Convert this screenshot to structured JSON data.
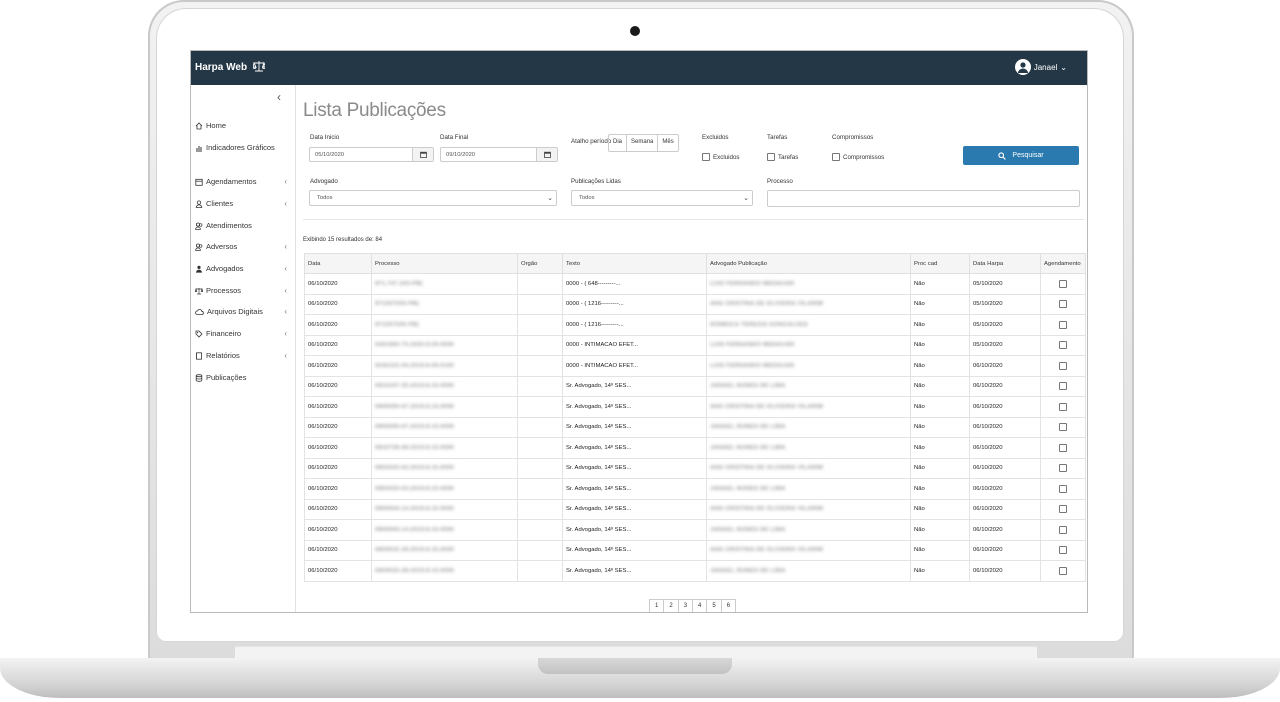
{
  "app": {
    "brand": "Harpa Web",
    "user": "Janael"
  },
  "sidebar": {
    "items": [
      {
        "label": "Home",
        "icon": "home-icon",
        "chevron": false
      },
      {
        "label": "Indicadores Gráficos",
        "icon": "chart-icon",
        "chevron": false
      },
      {
        "label": "Agendamentos",
        "icon": "calendar-icon",
        "chevron": true
      },
      {
        "label": "Clientes",
        "icon": "user-icon",
        "chevron": true
      },
      {
        "label": "Atendimentos",
        "icon": "users-icon",
        "chevron": false
      },
      {
        "label": "Adversos",
        "icon": "users-icon",
        "chevron": true
      },
      {
        "label": "Advogados",
        "icon": "lawyer-icon",
        "chevron": true
      },
      {
        "label": "Processos",
        "icon": "scale-icon",
        "chevron": true
      },
      {
        "label": "Arquivos Digitais",
        "icon": "cloud-icon",
        "chevron": true
      },
      {
        "label": "Financeiro",
        "icon": "tag-icon",
        "chevron": true
      },
      {
        "label": "Relatórios",
        "icon": "report-icon",
        "chevron": true
      },
      {
        "label": "Publicações",
        "icon": "database-icon",
        "chevron": false
      }
    ]
  },
  "page": {
    "title": "Lista Publicações"
  },
  "filters": {
    "data_inicio_label": "Data Inicio",
    "data_inicio_value": "05/10/2020",
    "data_final_label": "Data Final",
    "data_final_value": "09/10/2020",
    "atalho_label": "Atalho período",
    "atalho_options": [
      "Dia",
      "Semana",
      "Mês"
    ],
    "excluidos_title": "Excluidos",
    "excluidos_label": "Excluidos",
    "tarefas_title": "Tarefas",
    "tarefas_label": "Tarefas",
    "compromissos_title": "Compromissos",
    "compromissos_label": "Compromissos",
    "search_label": "Pesquisar",
    "advogado_label": "Advogado",
    "advogado_value": "Todos",
    "lidas_label": "Publicações Lidas",
    "lidas_value": "Todos",
    "processo_label": "Processo",
    "processo_value": ""
  },
  "summary": "Exibindo 15 resultados de: 84",
  "table": {
    "columns": [
      "Data",
      "Processo",
      "Orgão",
      "Texto",
      "Advogado Publicação",
      "Proc cad",
      "Data Harpa",
      "Agendamento"
    ],
    "rows": [
      [
        "06/10/2020",
        "Nº1.747.343-PB(",
        "",
        "0000 - ( 648---------...",
        "LUIS FERNANDO MEDAUAR",
        "Não",
        "05/10/2020"
      ],
      [
        "06/10/2020",
        "Nº1257035-PB(",
        "",
        "0000 - ( 1216---------...",
        "ANA CRISTINA DE OLIVEIRA VILARIM",
        "Não",
        "05/10/2020"
      ],
      [
        "06/10/2020",
        "Nº1257035-PB(",
        "",
        "0000 - ( 1216---------...",
        "ROMEICA TEREZIA GONCALVES",
        "Não",
        "05/10/2020"
      ],
      [
        "06/10/2020",
        "5401960-75.2020.8.09.0000",
        "",
        "0000 - INTIMACAO EFET...",
        "LUIS FERNANDO MEDAUAR",
        "Não",
        "05/10/2020"
      ],
      [
        "06/10/2020",
        "5042102-04.2019.8.09.0100",
        "",
        "0000 - INTIMACAO EFET...",
        "LUIS FERNANDO MEDAUAR",
        "Não",
        "06/10/2020"
      ],
      [
        "06/10/2020",
        "0812247-25.2019.8.15.0000",
        "",
        "Sr. Advogado, 14º SES...",
        "JANAEL NUNES DE LIMA",
        "Não",
        "06/10/2020"
      ],
      [
        "06/10/2020",
        "0805590-67.2019.8.15.0000",
        "",
        "Sr. Advogado, 14º SES...",
        "ANA CRISTINA DE OLIVEIRA VILARIM",
        "Não",
        "06/10/2020"
      ],
      [
        "06/10/2020",
        "0805590-67.2019.8.15.0000",
        "",
        "Sr. Advogado, 14º SES...",
        "JANAEL NUNES DE LIMA",
        "Não",
        "06/10/2020"
      ],
      [
        "06/10/2020",
        "0810738-58.2019.8.15.0000",
        "",
        "Sr. Advogado, 14º SES...",
        "JANAEL NUNES DE LIMA",
        "Não",
        "06/10/2020"
      ],
      [
        "06/10/2020",
        "0802020-63.2019.8.15.0000",
        "",
        "Sr. Advogado, 14º SES...",
        "ANA CRISTINA DE OLIVEIRA VILARIM",
        "Não",
        "06/10/2020"
      ],
      [
        "06/10/2020",
        "0802020-63.2019.8.15.0000",
        "",
        "Sr. Advogado, 14º SES...",
        "JANAEL NUNES DE LIMA",
        "Não",
        "06/10/2020"
      ],
      [
        "06/10/2020",
        "0800944-14.2019.8.15.0000",
        "",
        "Sr. Advogado, 14º SES...",
        "ANA CRISTINA DE OLIVEIRA VILARIM",
        "Não",
        "06/10/2020"
      ],
      [
        "06/10/2020",
        "0800944-14.2019.8.15.0000",
        "",
        "Sr. Advogado, 14º SES...",
        "JANAEL NUNES DE LIMA",
        "Não",
        "06/10/2020"
      ],
      [
        "06/10/2020",
        "0804532-28.2019.8.15.0000",
        "",
        "Sr. Advogado, 14º SES...",
        "ANA CRISTINA DE OLIVEIRA VILARIM",
        "Não",
        "06/10/2020"
      ],
      [
        "06/10/2020",
        "0804532-28.2019.8.15.0000",
        "",
        "Sr. Advogado, 14º SES...",
        "JANAEL NUNES DE LIMA",
        "Não",
        "06/10/2020"
      ]
    ]
  },
  "pagination": [
    "1",
    "2",
    "3",
    "4",
    "5",
    "6"
  ]
}
